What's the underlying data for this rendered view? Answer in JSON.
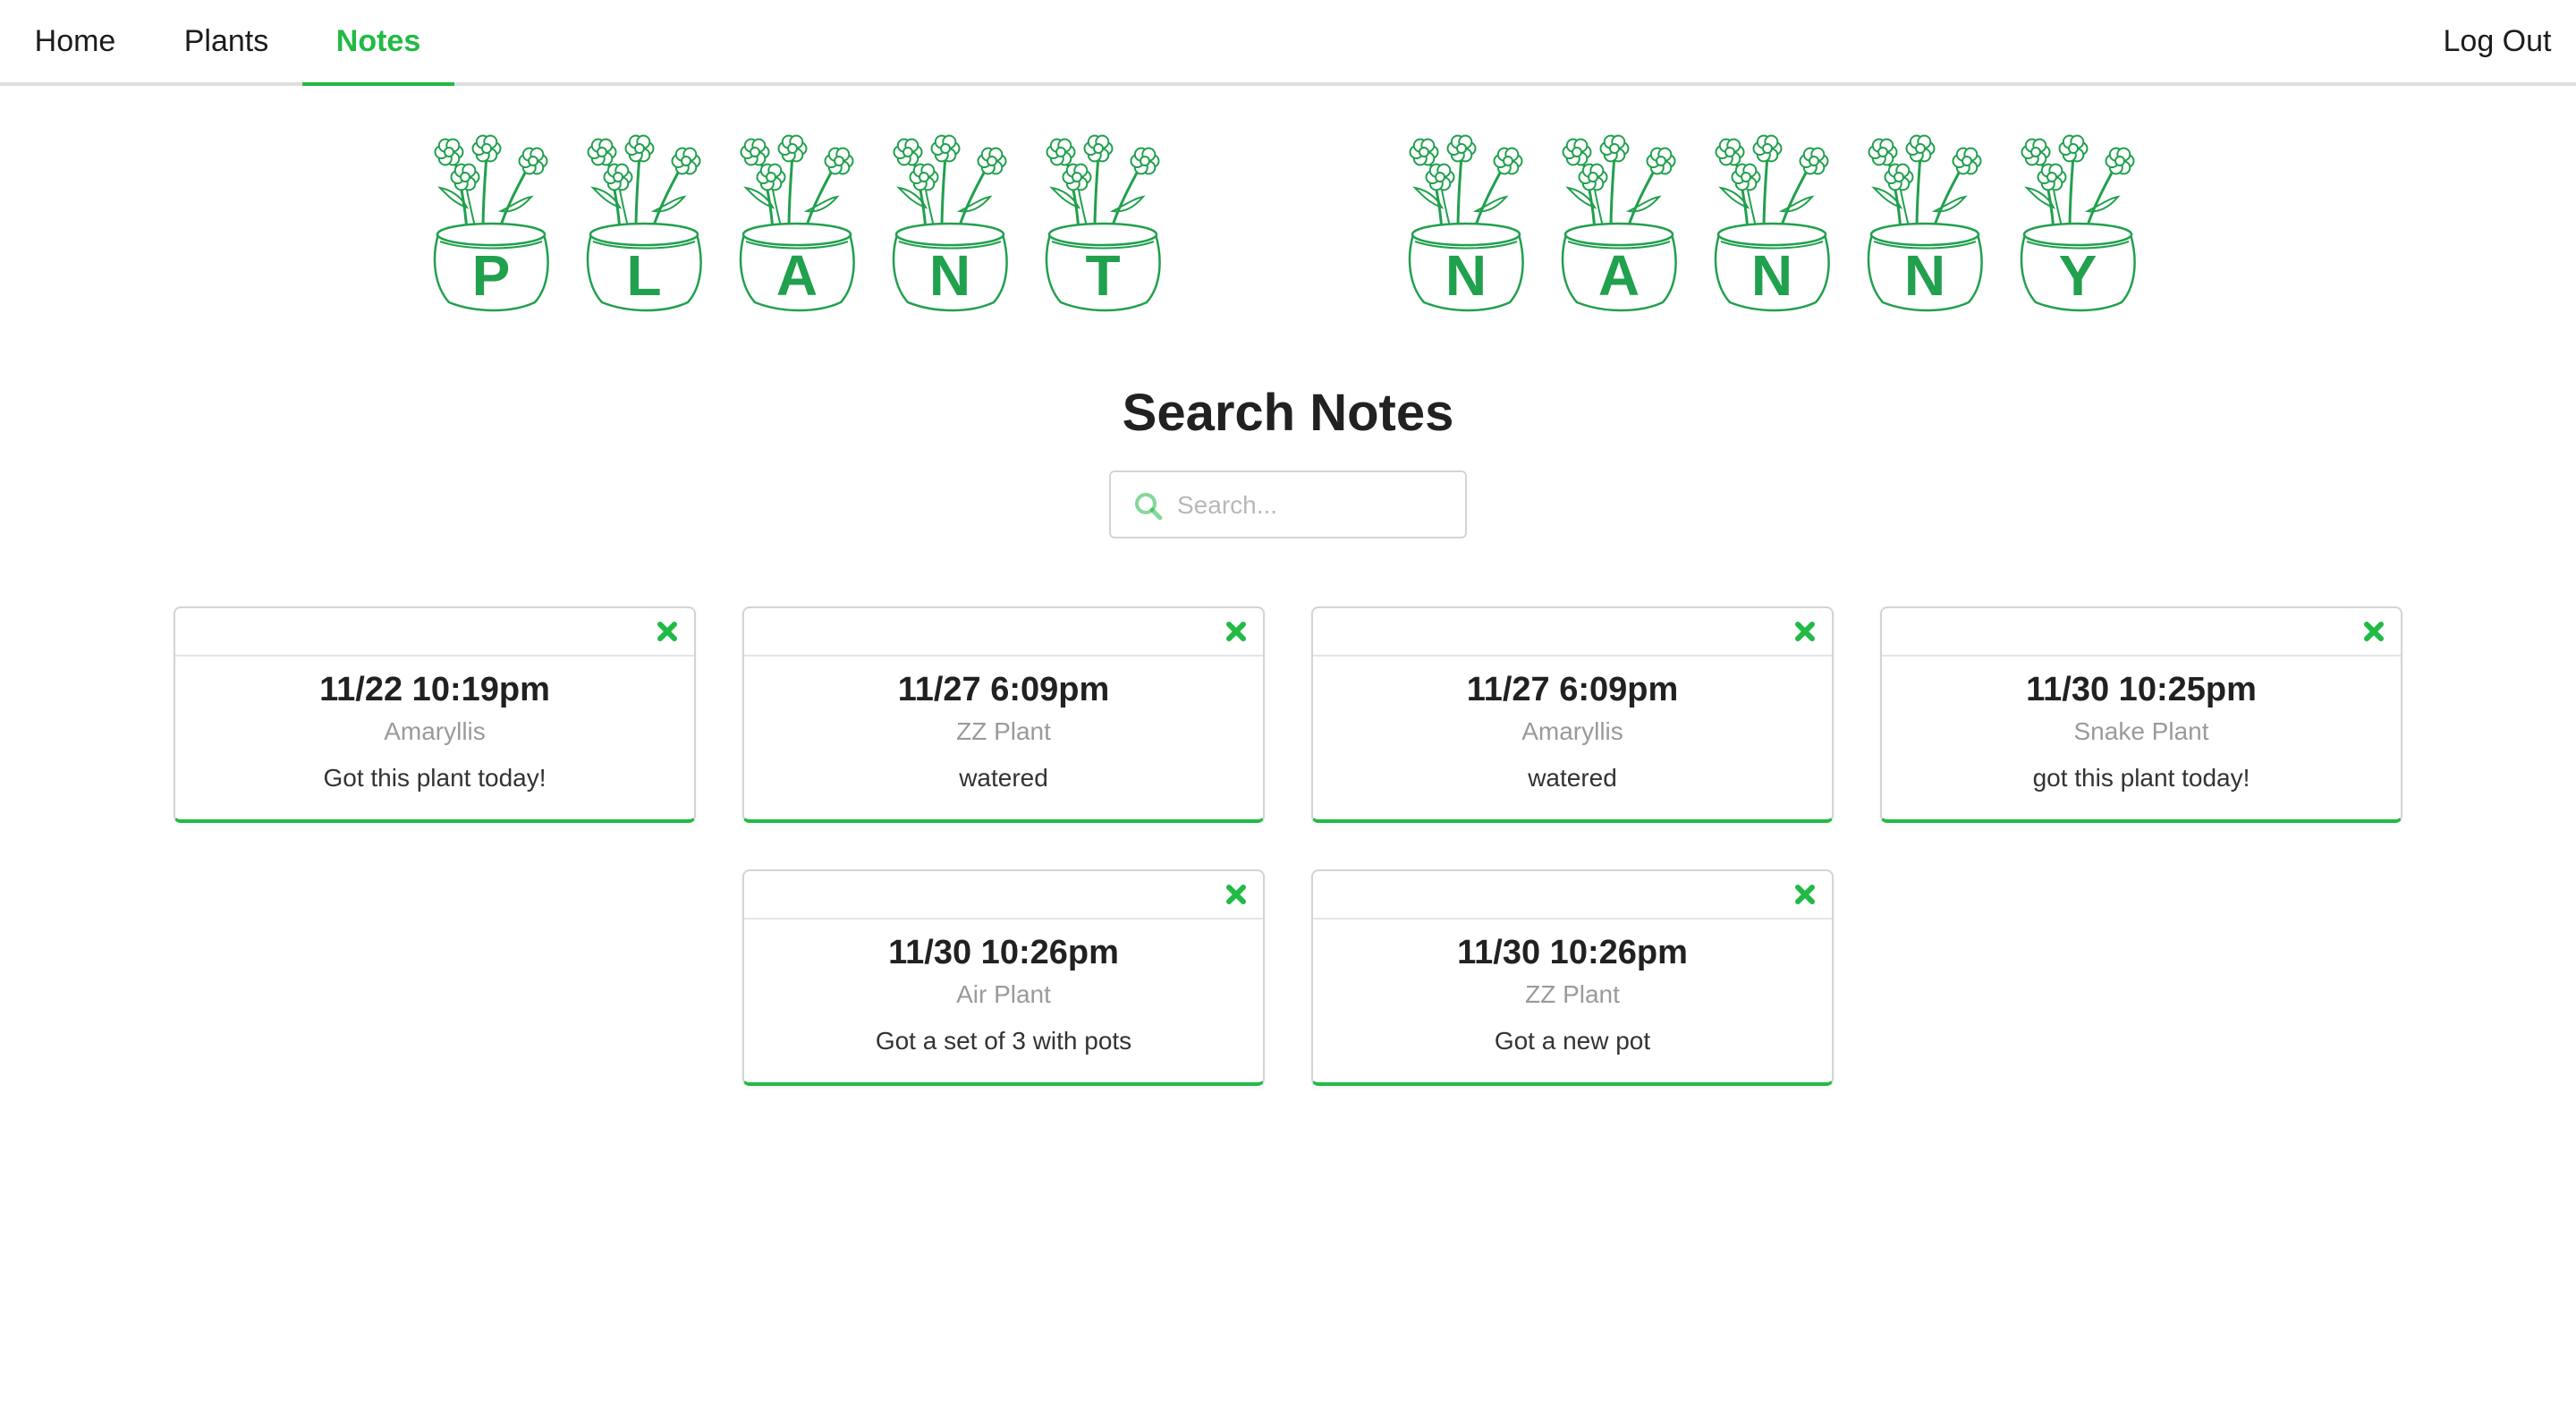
{
  "nav": {
    "home": "Home",
    "plants": "Plants",
    "notes": "Notes",
    "logout": "Log Out",
    "active": "notes"
  },
  "banner": {
    "letters": [
      "P",
      "L",
      "A",
      "N",
      "T",
      "N",
      "A",
      "N",
      "N",
      "Y"
    ],
    "color": "#21a04d"
  },
  "heading": "Search Notes",
  "search": {
    "placeholder": "Search...",
    "value": ""
  },
  "accent_color": "#21ba45",
  "notes": [
    {
      "time": "11/22 10:19pm",
      "plant": "Amaryllis",
      "text": "Got this plant today!"
    },
    {
      "time": "11/27 6:09pm",
      "plant": "ZZ Plant",
      "text": "watered"
    },
    {
      "time": "11/27 6:09pm",
      "plant": "Amaryllis",
      "text": "watered"
    },
    {
      "time": "11/30 10:25pm",
      "plant": "Snake Plant",
      "text": "got this plant today!"
    },
    {
      "time": "11/30 10:26pm",
      "plant": "Air Plant",
      "text": "Got a set of 3 with pots"
    },
    {
      "time": "11/30 10:26pm",
      "plant": "ZZ Plant",
      "text": "Got a new pot"
    }
  ],
  "icons": {
    "search": "search-icon",
    "close": "close-icon",
    "flower_pot": "flower-pot-icon"
  }
}
